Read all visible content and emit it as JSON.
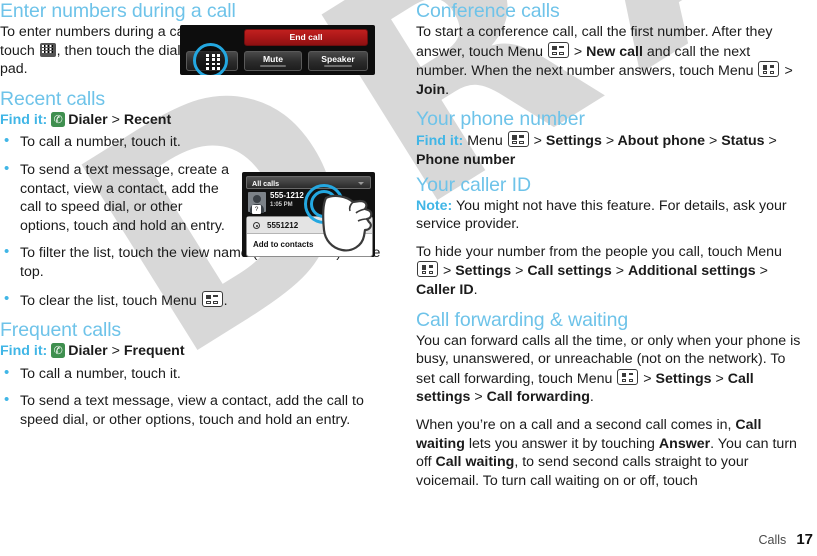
{
  "document": {
    "footer_label": "Calls",
    "page_number": "17",
    "watermark": "DRAFT",
    "heading_color": "#6ec3e9",
    "accent_color": "#41b6e6",
    "end_call_color": "#a81617",
    "dialer_icon_color": "#3f8f4f"
  },
  "left_column": {
    "section1": {
      "heading": "Enter numbers during a call",
      "para_a": "To enter numbers during a call, touch",
      "para_b": ", then touch the dial pad."
    },
    "section2": {
      "heading": "Recent calls",
      "findit_label": "Find it:",
      "findit_app": "Dialer",
      "findit_sep": ">",
      "findit_target": "Recent",
      "bullets": [
        "To call a number, touch it.",
        "To send a text message, create a contact, view a contact, add the call to speed dial, or other options, touch and hold an entry.",
        "To filter the list, touch the view name (like All calls) at the top.",
        "To clear the list, touch Menu ."
      ],
      "bullet3_pre": "To filter the list, touch the view name (like ",
      "bullet3_bold": "All calls",
      "bullet3_post": ") at the top.",
      "bullet4_pre": "To clear the list, touch Menu",
      "bullet4_post": "."
    },
    "section3": {
      "heading": "Frequent calls",
      "findit_label": "Find it:",
      "findit_app": "Dialer",
      "findit_sep": ">",
      "findit_target": "Frequent",
      "bullets": [
        "To call a number, touch it.",
        "To send a text message, view a contact, add the call to speed dial, or other options, touch and hold an entry."
      ]
    }
  },
  "right_column": {
    "section1": {
      "heading": "Conference calls",
      "text_a": "To start a conference call, call the first number. After they answer, touch Menu",
      "text_b": ">",
      "text_c": "New call",
      "text_d": "and call the next number. When the next number answers, touch Menu",
      "text_e": ">",
      "text_f": "Join",
      "text_g": "."
    },
    "section2": {
      "heading": "Your phone number",
      "findit_label": "Find it:",
      "findit_menu": "Menu",
      "path": [
        "Settings",
        "About phone",
        "Status",
        "Phone number"
      ],
      "sep": ">"
    },
    "section3": {
      "heading": "Your caller ID",
      "note_label": "Note:",
      "note_text": "You might not have this feature. For details, ask your service provider.",
      "para_a": "To hide your number from the people you call, touch Menu",
      "sep": ">",
      "path": [
        "Settings",
        "Call settings",
        "Additional settings",
        "Caller ID"
      ],
      "para_end": "."
    },
    "section4": {
      "heading": "Call forwarding & waiting",
      "para1_a": "You can forward calls all the time, or only when your phone is busy, unanswered, or unreachable (not on the network). To set call forwarding, touch Menu",
      "para1_sep": ">",
      "para1_path": [
        "Settings",
        "Call settings",
        "Call forwarding"
      ],
      "para1_end": ".",
      "para2_a": "When you’re on a call and a second call comes in,",
      "para2_b1": "Call waiting",
      "para2_c": "lets you answer it by touching",
      "para2_b2": "Answer",
      "para2_d": ". You can turn off",
      "para2_b3": "Call waiting",
      "para2_e": ", to send second calls straight to your voicemail. To turn call waiting on or off, touch"
    }
  },
  "screenshots": {
    "in_call": {
      "end_call_label": "End call",
      "mute_label": "Mute",
      "speaker_label": "Speaker",
      "highlighted_control": "dialpad-button"
    },
    "recent_calls": {
      "filter_label": "All calls",
      "entry_number": "555-1212",
      "entry_time": "1:05 PM",
      "popup_title": "5551212",
      "popup_item": "Add to contacts"
    }
  }
}
